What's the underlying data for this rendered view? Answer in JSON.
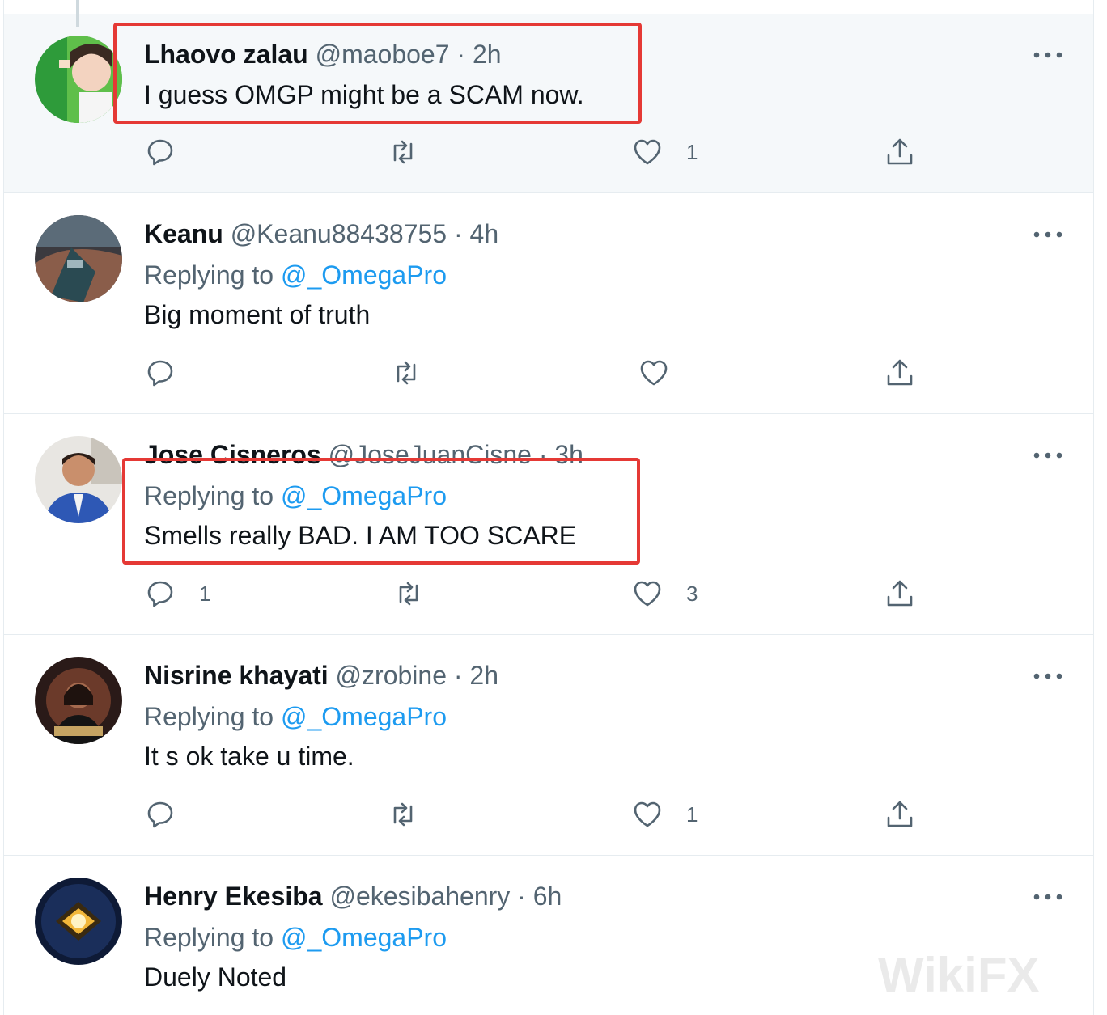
{
  "tweets": [
    {
      "name": "Lhaovo zalau",
      "handle": "@maoboe7",
      "time": "2h",
      "replying_prefix": "",
      "replying_to": "",
      "text": "I guess OMGP might be a SCAM now.",
      "reply_count": "",
      "retweet_count": "",
      "like_count": "1"
    },
    {
      "name": "Keanu",
      "handle": "@Keanu88438755",
      "time": "4h",
      "replying_prefix": "Replying to",
      "replying_to": "@_OmegaPro",
      "text": "Big moment of truth",
      "reply_count": "",
      "retweet_count": "",
      "like_count": ""
    },
    {
      "name": "Jose Cisneros",
      "handle": "@JoseJuanCisne",
      "time": "3h",
      "replying_prefix": "Replying to",
      "replying_to": "@_OmegaPro",
      "text": "Smells really BAD. I AM TOO SCARE",
      "reply_count": "1",
      "retweet_count": "",
      "like_count": "3"
    },
    {
      "name": "Nisrine khayati",
      "handle": "@zrobine",
      "time": "2h",
      "replying_prefix": "Replying to",
      "replying_to": "@_OmegaPro",
      "text": "It s ok take u time.",
      "reply_count": "",
      "retweet_count": "",
      "like_count": "1"
    },
    {
      "name": "Henry Ekesiba",
      "handle": "@ekesibahenry",
      "time": "6h",
      "replying_prefix": "Replying to",
      "replying_to": "@_OmegaPro",
      "text": "Duely Noted",
      "reply_count": "",
      "retweet_count": "",
      "like_count": ""
    }
  ],
  "separator": "·",
  "icons": {
    "reply": "reply-icon",
    "retweet": "retweet-icon",
    "like": "heart-icon",
    "share": "share-icon",
    "more": "more-icon"
  },
  "colors": {
    "accent": "#1d9bf0",
    "annotation": "#e53935",
    "muted": "#536471"
  },
  "watermark": "WikiFX"
}
